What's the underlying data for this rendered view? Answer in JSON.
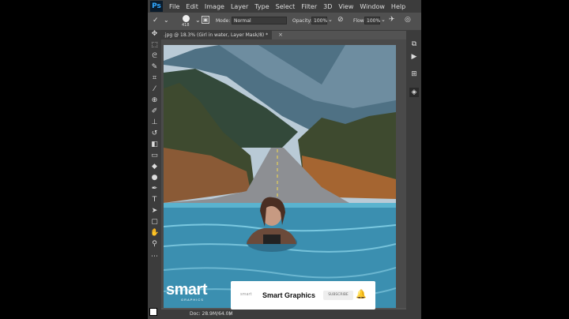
{
  "app": {
    "logo": "Ps",
    "menu": [
      "File",
      "Edit",
      "Image",
      "Layer",
      "Type",
      "Select",
      "Filter",
      "3D",
      "View",
      "Window",
      "Help"
    ]
  },
  "options": {
    "brush_size": "418",
    "mode_label": "Mode:",
    "mode_value": "Normal",
    "opacity_label": "Opacity:",
    "opacity_value": "100%",
    "flow_label": "Flow:",
    "flow_value": "100%"
  },
  "document": {
    "tab_title": ".jpg @ 18.3% (Girl in water, Layer Mask/8) *",
    "close_glyph": "×"
  },
  "status": {
    "doc_info": "Doc: 28.9M/64.0M"
  },
  "overlay": {
    "logo_text": "smart",
    "logo_sub": "GRAPHICS",
    "channel_name": "Smart Graphics",
    "channel_mini": "smart",
    "subscribe_label": "SUBSCRIBE"
  },
  "colors": {
    "sky": "#b9cad6",
    "mountain": "#4f7184",
    "forest": "#3e4a2f",
    "road": "#8d8f93",
    "water": "#3b8fb0"
  },
  "icons": {
    "tools": [
      "move-icon",
      "marquee-icon",
      "lasso-icon",
      "quick-select-icon",
      "crop-icon",
      "eyedropper-icon",
      "healing-icon",
      "brush-icon",
      "stamp-icon",
      "history-brush-icon",
      "eraser-icon",
      "gradient-icon",
      "blur-icon",
      "dodge-icon",
      "pen-icon",
      "type-icon",
      "path-select-icon",
      "shape-icon",
      "hand-icon",
      "zoom-icon"
    ],
    "panels": [
      "history-icon",
      "actions-icon",
      "adjustments-icon",
      "layers-icon"
    ]
  }
}
